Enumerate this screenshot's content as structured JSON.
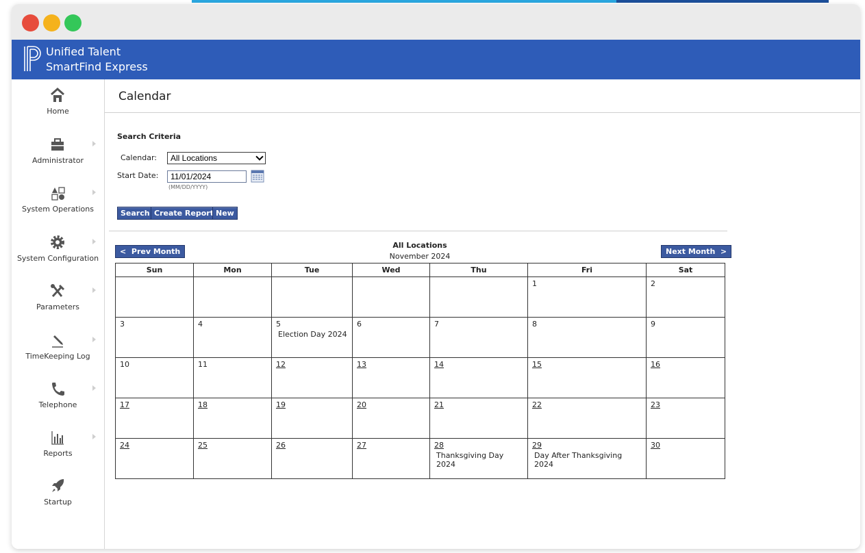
{
  "app": {
    "brand_line1": "Unified Talent",
    "brand_line2": "SmartFind Express",
    "header_color": "#2e5cb8"
  },
  "sidebar": {
    "items": [
      {
        "label": "Home",
        "icon": "home-icon",
        "has_submenu": false
      },
      {
        "label": "Administrator",
        "icon": "briefcase-icon",
        "has_submenu": true
      },
      {
        "label": "System Operations",
        "icon": "shapes-icon",
        "has_submenu": true
      },
      {
        "label": "System Configuration",
        "icon": "gear-icon",
        "has_submenu": true
      },
      {
        "label": "Parameters",
        "icon": "tools-icon",
        "has_submenu": true
      },
      {
        "label": "TimeKeeping Log",
        "icon": "pen-icon",
        "has_submenu": true
      },
      {
        "label": "Telephone",
        "icon": "phone-icon",
        "has_submenu": true
      },
      {
        "label": "Reports",
        "icon": "bar-chart-icon",
        "has_submenu": true
      },
      {
        "label": "Startup",
        "icon": "rocket-icon",
        "has_submenu": false
      }
    ]
  },
  "page": {
    "title": "Calendar"
  },
  "search": {
    "section_title": "Search Criteria",
    "calendar_label": "Calendar:",
    "calendar_value": "All Locations",
    "start_date_label": "Start Date:",
    "start_date_value": "11/01/2024",
    "date_hint": "(MM/DD/YYYY)",
    "buttons": {
      "search": "Search",
      "create_report": "Create Report",
      "new": "New"
    }
  },
  "calendar": {
    "prev_label": "<  Prev Month",
    "next_label": "Next Month  >",
    "location": "All Locations",
    "month": "November 2024",
    "weekdays": [
      "Sun",
      "Mon",
      "Tue",
      "Wed",
      "Thu",
      "Fri",
      "Sat"
    ],
    "weeks": [
      [
        {
          "day": "",
          "link": false,
          "event": ""
        },
        {
          "day": "",
          "link": false,
          "event": ""
        },
        {
          "day": "",
          "link": false,
          "event": ""
        },
        {
          "day": "",
          "link": false,
          "event": ""
        },
        {
          "day": "",
          "link": false,
          "event": ""
        },
        {
          "day": "1",
          "link": false,
          "event": ""
        },
        {
          "day": "2",
          "link": false,
          "event": ""
        }
      ],
      [
        {
          "day": "3",
          "link": false,
          "event": ""
        },
        {
          "day": "4",
          "link": false,
          "event": ""
        },
        {
          "day": "5",
          "link": false,
          "event": "Election Day 2024"
        },
        {
          "day": "6",
          "link": false,
          "event": ""
        },
        {
          "day": "7",
          "link": false,
          "event": ""
        },
        {
          "day": "8",
          "link": false,
          "event": ""
        },
        {
          "day": "9",
          "link": false,
          "event": ""
        }
      ],
      [
        {
          "day": "10",
          "link": false,
          "event": ""
        },
        {
          "day": "11",
          "link": false,
          "event": ""
        },
        {
          "day": "12",
          "link": true,
          "event": ""
        },
        {
          "day": "13",
          "link": true,
          "event": ""
        },
        {
          "day": "14",
          "link": true,
          "event": ""
        },
        {
          "day": "15",
          "link": true,
          "event": ""
        },
        {
          "day": "16",
          "link": true,
          "event": ""
        }
      ],
      [
        {
          "day": "17",
          "link": true,
          "event": ""
        },
        {
          "day": "18",
          "link": true,
          "event": ""
        },
        {
          "day": "19",
          "link": true,
          "event": ""
        },
        {
          "day": "20",
          "link": true,
          "event": ""
        },
        {
          "day": "21",
          "link": true,
          "event": ""
        },
        {
          "day": "22",
          "link": true,
          "event": ""
        },
        {
          "day": "23",
          "link": true,
          "event": ""
        }
      ],
      [
        {
          "day": "24",
          "link": true,
          "event": ""
        },
        {
          "day": "25",
          "link": true,
          "event": ""
        },
        {
          "day": "26",
          "link": true,
          "event": ""
        },
        {
          "day": "27",
          "link": true,
          "event": ""
        },
        {
          "day": "28",
          "link": true,
          "event": "Thanksgiving Day 2024"
        },
        {
          "day": "29",
          "link": true,
          "event": "Day After Thanksgiving 2024"
        },
        {
          "day": "30",
          "link": true,
          "event": ""
        }
      ]
    ]
  }
}
